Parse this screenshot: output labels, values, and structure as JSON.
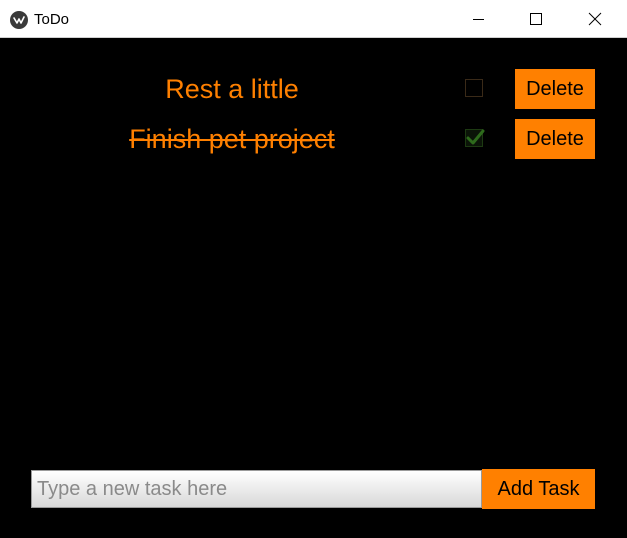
{
  "window": {
    "title": "ToDo",
    "controls": [
      "minimize",
      "maximize",
      "close"
    ]
  },
  "tasks": [
    {
      "label": "Rest a little",
      "done": false,
      "delete_label": "Delete"
    },
    {
      "label": "Finish pet project",
      "done": true,
      "delete_label": "Delete"
    }
  ],
  "new_task": {
    "value": "",
    "placeholder": "Type a new task here",
    "add_label": "Add Task"
  },
  "colors": {
    "accent": "#ff8000",
    "background": "#000000",
    "check": "#2e6b1c"
  },
  "icons": [
    "app-logo-icon",
    "minimize-icon",
    "maximize-icon",
    "close-icon",
    "checkmark-icon"
  ]
}
